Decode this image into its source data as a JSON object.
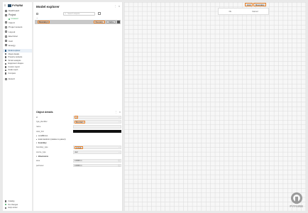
{
  "app": {
    "name": "PYFARM"
  },
  "sidebar": {
    "items": [
      {
        "label": "Dashboard",
        "icon": "home-icon"
      },
      {
        "label": "Project",
        "icon": "folder-icon"
      }
    ],
    "project_status": "Unsaved",
    "items2": [
      {
        "label": "Import",
        "icon": "import-icon"
      },
      {
        "label": "Project assets",
        "icon": "assets-icon"
      },
      {
        "label": "Layout",
        "icon": "layout-icon"
      },
      {
        "label": "Electrical",
        "icon": "electrical-icon"
      },
      {
        "label": "Civil",
        "icon": "civil-icon"
      },
      {
        "label": "Energy",
        "icon": "energy-icon"
      }
    ],
    "subitems": [
      {
        "label": "Model explorer",
        "icon": "model-icon",
        "active": true
      },
      {
        "label": "Object details",
        "icon": "details-icon"
      },
      {
        "label": "Property analysis",
        "icon": "property-icon"
      },
      {
        "label": "Terrain analysis",
        "icon": "terrain-icon"
      },
      {
        "label": "Equipment shapes",
        "icon": "shapes-icon"
      },
      {
        "label": "Custom report",
        "icon": "report-icon"
      },
      {
        "label": "Scale report",
        "icon": "scale-icon"
      },
      {
        "label": "Compare",
        "icon": "compare-icon"
      }
    ],
    "export_label": "Export",
    "catalog_label": "Catalog",
    "no_changes_label": "No changes",
    "help_label": "Help center"
  },
  "explorer": {
    "title": "Model explorer",
    "search_placeholder": "Search objects",
    "tree_row": {
      "label": "Boundary 1",
      "pill1": "Boundary",
      "pill2": "Outline"
    }
  },
  "details": {
    "title": "Object details",
    "fields": [
      {
        "key": "id",
        "value": "1"
      },
      {
        "key": "type_identifier",
        "value": "Boundary"
      },
      {
        "key": "name",
        "value": ""
      },
      {
        "key": "color_hint",
        "value": ""
      }
    ],
    "sections": [
      "LocalBonus",
      "local transform (relative to parent)",
      "boundary"
    ],
    "boundary_fields": [
      {
        "key": "boundary_type",
        "value": "include"
      },
      {
        "key": "source_type",
        "value": "user"
      }
    ],
    "dimensions_title": "dimensions",
    "dimension_fields": [
      {
        "key": "area",
        "value": "0.0000 m"
      },
      {
        "key": "perimeter",
        "value": "0.0000 m"
      }
    ]
  },
  "viewer": {
    "tabs": [
      "Grid",
      "Boundary"
    ],
    "dialog": {
      "yes": "Ok",
      "cancel": "Cancel"
    },
    "watermark": "PYFARM"
  },
  "colors": {
    "accent": "#e8822b",
    "brand": "#2e4f6a",
    "status": "#3ba55c"
  }
}
